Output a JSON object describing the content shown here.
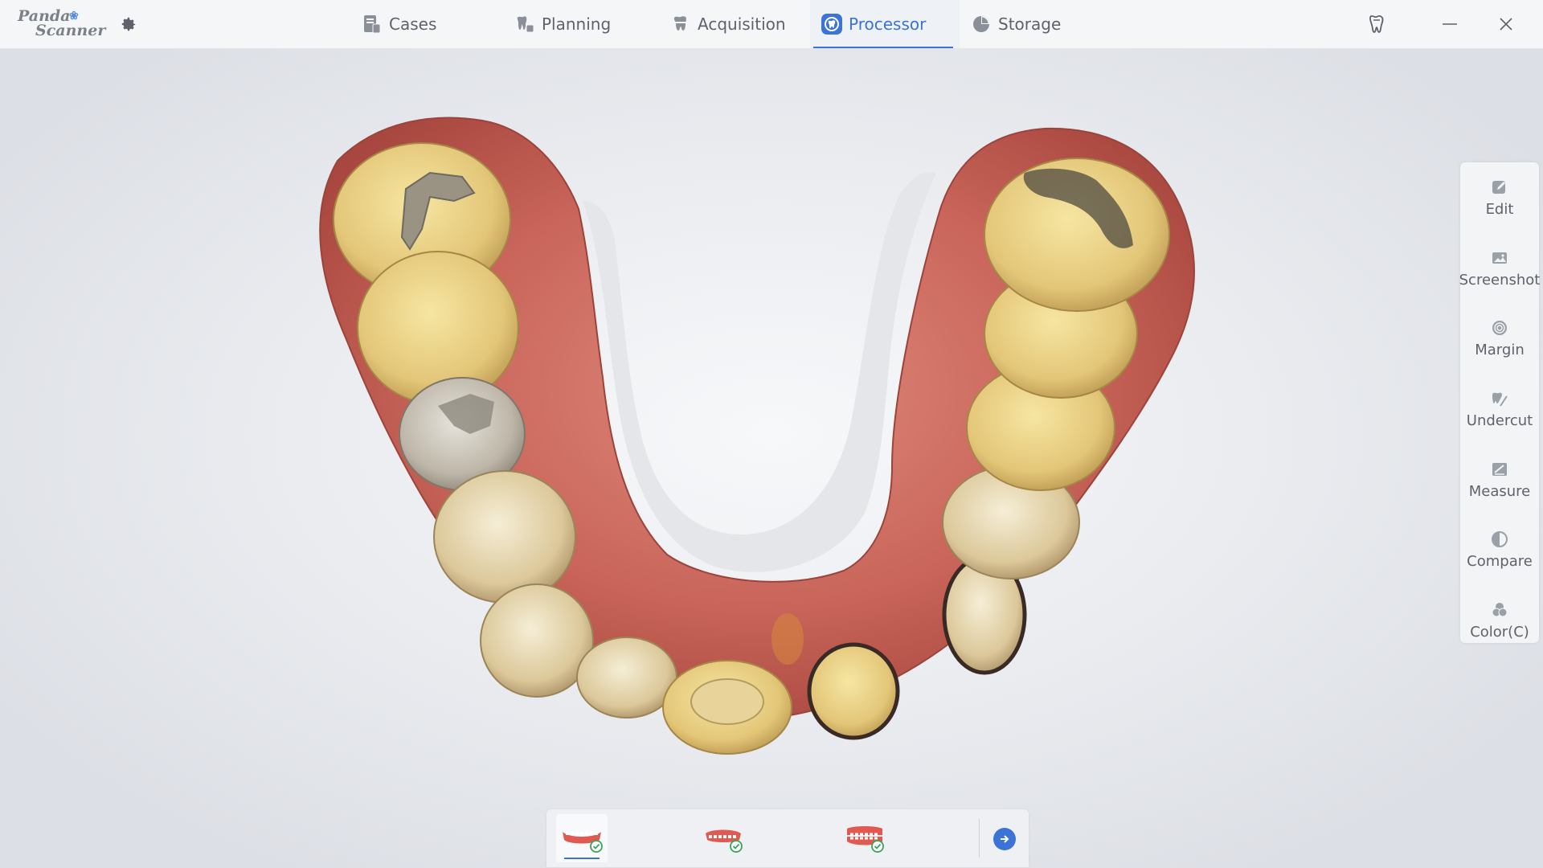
{
  "app": {
    "logo_line1": "Panda",
    "logo_line2": "Scanner"
  },
  "nav": {
    "tabs": [
      {
        "label": "Cases",
        "icon": "cases-icon"
      },
      {
        "label": "Planning",
        "icon": "planning-icon"
      },
      {
        "label": "Acquisition",
        "icon": "acquisition-icon"
      },
      {
        "label": "Processor",
        "icon": "processor-icon",
        "active": true
      },
      {
        "label": "Storage",
        "icon": "storage-icon"
      }
    ]
  },
  "tools": [
    {
      "label": "Edit",
      "icon": "edit-icon"
    },
    {
      "label": "Screenshot",
      "icon": "screenshot-icon"
    },
    {
      "label": "Margin",
      "icon": "margin-icon"
    },
    {
      "label": "Undercut",
      "icon": "undercut-icon"
    },
    {
      "label": "Measure",
      "icon": "measure-icon"
    },
    {
      "label": "Compare",
      "icon": "compare-icon"
    },
    {
      "label": "Color(C)",
      "icon": "color-icon"
    }
  ],
  "bottom": {
    "jaws": [
      {
        "icon": "lower-jaw-icon",
        "status": "done",
        "active": true
      },
      {
        "icon": "upper-jaw-icon",
        "status": "done"
      },
      {
        "icon": "bite-icon",
        "status": "done"
      }
    ],
    "next_icon": "arrow-right-icon"
  },
  "colors": {
    "accent": "#3b73d6",
    "gum": "#c9655a",
    "tooth": "#e8cf86"
  }
}
